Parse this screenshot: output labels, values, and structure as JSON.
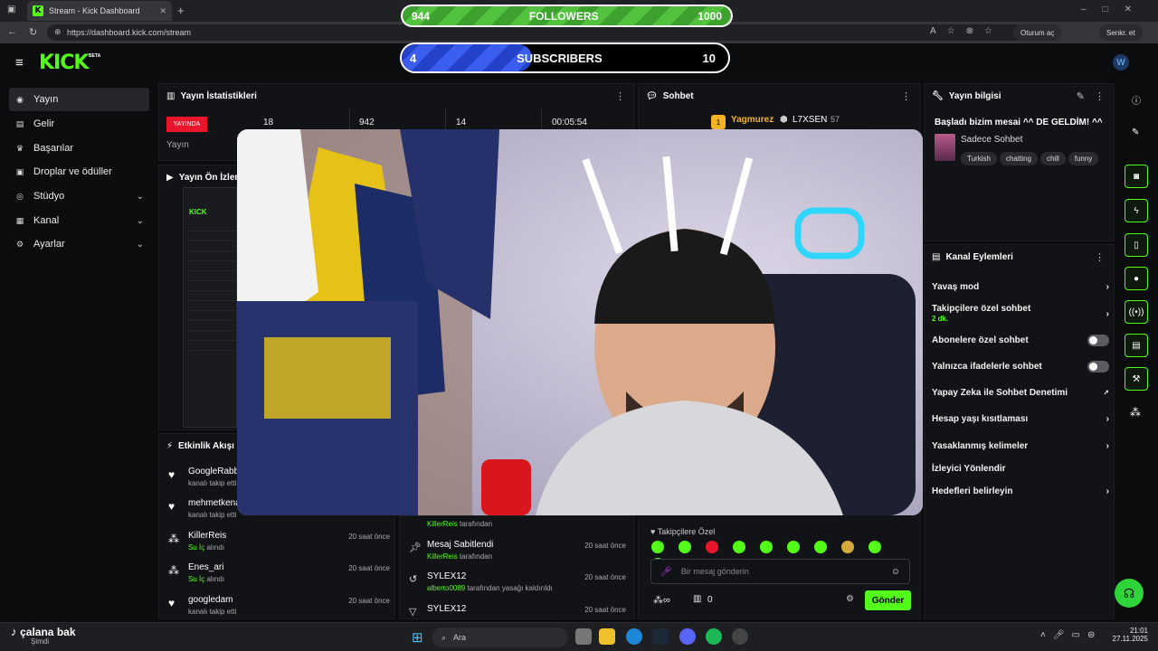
{
  "browser": {
    "tab_title": "Stream - Kick Dashboard",
    "url": "https://dashboard.kick.com/stream",
    "profile_button": "Oturum aç",
    "sync_button": "Senkr. et"
  },
  "kick": {
    "logo": "KICK",
    "beta": "BETA"
  },
  "sidebar": {
    "items": [
      {
        "label": "Yayın",
        "icon": "broadcast-icon"
      },
      {
        "label": "Gelir",
        "icon": "revenue-icon"
      },
      {
        "label": "Başarılar",
        "icon": "trophy-icon"
      },
      {
        "label": "Droplar ve ödüller",
        "icon": "gift-icon"
      },
      {
        "label": "Stüdyo",
        "icon": "studio-icon"
      },
      {
        "label": "Kanal",
        "icon": "channel-icon"
      },
      {
        "label": "Ayarlar",
        "icon": "gear-icon"
      }
    ]
  },
  "overlay": {
    "followers": {
      "current": "944",
      "label": "FOLLOWERS",
      "goal": "1000",
      "progress": 0.944
    },
    "subscribers": {
      "current": "4",
      "label": "SUBSCRIBERS",
      "goal": "10",
      "progress": 0.4
    }
  },
  "stats": {
    "title": "Yayın İstatistikleri",
    "live_badge": "YAYINDA",
    "live_label": "Yayın",
    "values": [
      "18",
      "942",
      "14",
      "00:05:54"
    ]
  },
  "preview": {
    "title": "Yayın Ön İzleme"
  },
  "chat": {
    "title": "Sohbet",
    "top_user": "Yagmurez",
    "top_user2": "L7XSEN",
    "top_count": "57",
    "followers_only": "Takipçilere Özel",
    "input_placeholder": "Bir mesaj gönderin",
    "count": "0",
    "send_button": "Gönder"
  },
  "mod_log": [
    {
      "name": "",
      "sub_user": "KillerReis",
      "sub_text": "tarafından",
      "time": ""
    },
    {
      "name": "Mesaj Sabitlendi",
      "sub_user": "KillerReis",
      "sub_text": "tarafından",
      "time": "20 saat önce"
    },
    {
      "name": "SYLEX12",
      "sub_user": "alberto0089",
      "sub_text": "tarafından yasağı kaldırıldı",
      "time": "20 saat önce"
    },
    {
      "name": "SYLEX12",
      "sub_user": "",
      "sub_text": "",
      "time": "20 saat önce"
    }
  ],
  "activity": {
    "title": "Etkinlik Akışı",
    "items": [
      {
        "name": "GoogleRabbi",
        "sub_g": "",
        "sub": "kanalı takip etti",
        "time": ""
      },
      {
        "name": "mehmetkenan",
        "sub_g": "",
        "sub": "kanalı takip etti",
        "time": ""
      },
      {
        "name": "KillerReis",
        "sub_g": "Su İç",
        "sub": "alındı",
        "time": "20 saat önce"
      },
      {
        "name": "Enes_ari",
        "sub_g": "Su İç",
        "sub": "alındı",
        "time": "20 saat önce"
      },
      {
        "name": "googledam",
        "sub_g": "",
        "sub": "kanalı takip etti",
        "time": "20 saat önce"
      }
    ]
  },
  "stream_info": {
    "title": "Yayın bilgisi",
    "stream_title": "Başladı bizim mesai ^^ DE GELDİM! ^^",
    "category": "Sadece Sohbet",
    "tags": [
      "Turkish",
      "chatting",
      "chill",
      "funny"
    ]
  },
  "channel_actions": {
    "title": "Kanal Eylemleri",
    "items": [
      {
        "label": "Yavaş mod",
        "sub": "",
        "control": "chevron"
      },
      {
        "label": "Takipçilere özel sohbet",
        "sub": "2 dk.",
        "control": "chevron"
      },
      {
        "label": "Abonelere özel sohbet",
        "sub": "",
        "control": "toggle"
      },
      {
        "label": "Yalnızca ifadelerle sohbet",
        "sub": "",
        "control": "toggle"
      },
      {
        "label": "Yapay Zeka ile Sohbet Denetimi",
        "sub": "",
        "control": "external"
      },
      {
        "label": "Hesap yaşı kısıtlaması",
        "sub": "",
        "control": "chevron"
      },
      {
        "label": "Yasaklanmış kelimeler",
        "sub": "",
        "control": "chevron"
      },
      {
        "label": "İzleyici Yönlendir",
        "sub": "",
        "control": "none"
      },
      {
        "label": "Hedefleri belirleyin",
        "sub": "",
        "control": "chevron"
      }
    ]
  },
  "taskbar": {
    "now_playing_title": "çalana bak",
    "now_playing_sub": "Şimdi",
    "search": "Ara",
    "time": "21:01",
    "date": "27.11.2025"
  },
  "colors": {
    "kick_green": "#53fc18",
    "live_red": "#e9162b",
    "follow_bar": "#3da12e",
    "sub_bar": "#2341c9"
  }
}
